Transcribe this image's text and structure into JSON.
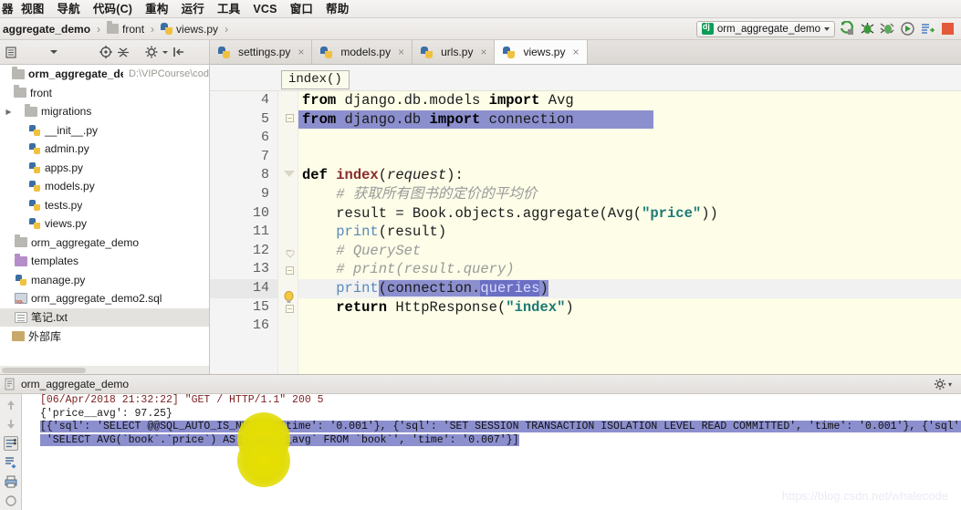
{
  "menu": {
    "items": [
      "器",
      "视图",
      "导航",
      "代码(C)",
      "重构",
      "运行",
      "工具",
      "VCS",
      "窗口",
      "帮助"
    ]
  },
  "breadcrumb": {
    "project": "aggregate_demo",
    "folder": "front",
    "file": "views.py",
    "sep": "›"
  },
  "run_config": {
    "name": "orm_aggregate_demo",
    "icon": "django-icon",
    "dropdown_caret": "▾",
    "buttons": [
      {
        "name": "run-button",
        "label": "Run"
      },
      {
        "name": "debug-button",
        "label": "Debug"
      },
      {
        "name": "coverage-button",
        "label": "Run with Coverage"
      },
      {
        "name": "profile-button",
        "label": "Profile"
      },
      {
        "name": "attach-button",
        "label": "Attach"
      },
      {
        "name": "stop-button",
        "label": "Stop"
      }
    ]
  },
  "project_toolbar": {
    "icons": [
      "list-icon",
      "chevron-down-icon",
      "target-icon",
      "collapse-all-icon",
      "gear-icon",
      "hide-icon"
    ]
  },
  "tabs": [
    {
      "label": "settings.py",
      "active": false,
      "close": "×"
    },
    {
      "label": "models.py",
      "active": false,
      "close": "×"
    },
    {
      "label": "urls.py",
      "active": false,
      "close": "×"
    },
    {
      "label": "views.py",
      "active": true,
      "close": "×"
    }
  ],
  "project_tree": [
    {
      "indent": 0,
      "twist": "",
      "icon": "folder",
      "label": "orm_aggregate_demo",
      "path": "D:\\VIPCourse\\cod",
      "bold": true,
      "selected": false
    },
    {
      "indent": 1,
      "twist": "",
      "icon": "folder",
      "label": "front",
      "path": "",
      "bold": false,
      "selected": false
    },
    {
      "indent": 2,
      "twist": "▶",
      "icon": "folder",
      "label": "migrations",
      "path": "",
      "bold": false,
      "selected": false
    },
    {
      "indent": 3,
      "twist": "",
      "icon": "py",
      "label": "__init__.py",
      "path": "",
      "bold": false,
      "selected": false
    },
    {
      "indent": 3,
      "twist": "",
      "icon": "py",
      "label": "admin.py",
      "path": "",
      "bold": false,
      "selected": false
    },
    {
      "indent": 3,
      "twist": "",
      "icon": "py",
      "label": "apps.py",
      "path": "",
      "bold": false,
      "selected": false
    },
    {
      "indent": 3,
      "twist": "",
      "icon": "py",
      "label": "models.py",
      "path": "",
      "bold": false,
      "selected": false
    },
    {
      "indent": 3,
      "twist": "",
      "icon": "py",
      "label": "tests.py",
      "path": "",
      "bold": false,
      "selected": false
    },
    {
      "indent": 3,
      "twist": "",
      "icon": "py",
      "label": "views.py",
      "path": "",
      "bold": false,
      "selected": false
    },
    {
      "indent": 1,
      "twist": "",
      "icon": "folder",
      "label": "orm_aggregate_demo",
      "path": "",
      "bold": false,
      "selected": false
    },
    {
      "indent": 1,
      "twist": "",
      "icon": "folderPurple",
      "label": "templates",
      "path": "",
      "bold": false,
      "selected": false
    },
    {
      "indent": 1,
      "twist": "",
      "icon": "py",
      "label": "manage.py",
      "path": "",
      "bold": false,
      "selected": false
    },
    {
      "indent": 1,
      "twist": "",
      "icon": "sql",
      "label": "orm_aggregate_demo2.sql",
      "path": "",
      "bold": false,
      "selected": false
    },
    {
      "indent": 1,
      "twist": "",
      "icon": "txt",
      "label": "笔记.txt",
      "path": "",
      "bold": false,
      "selected": true
    },
    {
      "indent": 0,
      "twist": "",
      "icon": "lib",
      "label": "外部库",
      "path": "",
      "bold": false,
      "selected": false
    }
  ],
  "editor": {
    "breadcrumb_chip": "index()",
    "first_line_number": 4,
    "current_line": 14,
    "line_numbers": [
      4,
      5,
      6,
      7,
      8,
      9,
      10,
      11,
      12,
      13,
      14,
      15,
      16
    ],
    "lines": [
      {
        "n": 4,
        "text": "from django.db.models import Avg"
      },
      {
        "n": 5,
        "text": "from django.db import connection"
      },
      {
        "n": 6,
        "text": ""
      },
      {
        "n": 7,
        "text": ""
      },
      {
        "n": 8,
        "text": "def index(request):"
      },
      {
        "n": 9,
        "text": "    # 获取所有图书的定价的平均价"
      },
      {
        "n": 10,
        "text": "    result = Book.objects.aggregate(Avg(\"price\"))"
      },
      {
        "n": 11,
        "text": "    print(result)"
      },
      {
        "n": 12,
        "text": "    # QuerySet"
      },
      {
        "n": 13,
        "text": "    # print(result.query)"
      },
      {
        "n": 14,
        "text": "    print(connection.queries)"
      },
      {
        "n": 15,
        "text": "    return HttpResponse(\"index\")"
      },
      {
        "n": 16,
        "text": ""
      }
    ],
    "tokens": {
      "l4": {
        "kw1": "from",
        "mod": " django.db.models ",
        "kw2": "import",
        "name": " Avg"
      },
      "l5": {
        "kw1": "from",
        "mod": " django.db ",
        "kw2": "import",
        "name": " connection"
      },
      "l8": {
        "kw": "def",
        "fn": "index",
        "open": "(",
        "param": "request",
        "close": "):"
      },
      "l9": {
        "comment": "# 获取所有图书的定价的平均价"
      },
      "l10": {
        "lhs": "result = Book.objects.aggregate(Avg(",
        "str": "\"price\"",
        "rhs": "))"
      },
      "l11": {
        "fn": "print",
        "rest": "(result)"
      },
      "l12": {
        "comment": "# QuerySet"
      },
      "l13": {
        "comment": "# print(result.query)"
      },
      "l14": {
        "fn": "print",
        "mid": "(connection.",
        "selected": "queries",
        "end": ")"
      },
      "l15": {
        "kw": "return",
        "mid": " HttpResponse(",
        "str": "\"index\"",
        "end": ")"
      }
    },
    "selection": {
      "from_line": 5,
      "to_line": 5,
      "label": "import-line-selection"
    }
  },
  "run_panel": {
    "title": "orm_aggregate_demo",
    "gear_icon": "gear-icon",
    "gear_caret": "▾",
    "toolbar_icons": [
      "scroll-up-icon",
      "scroll-down-icon",
      "soft-wrap-icon",
      "scroll-to-end-icon",
      "print-icon",
      "clear-icon"
    ],
    "console_lines": [
      {
        "style": "request",
        "text": "[06/Apr/2018 21:32:22] \"GET / HTTP/1.1\" 200 5"
      },
      {
        "style": "plain",
        "text": "{'price__avg': 97.25}"
      },
      {
        "style": "highlight",
        "text": "[{'sql': 'SELECT @@SQL_AUTO_IS_NULL', 'time': '0.001'}, {'sql': 'SET SESSION TRANSACTION ISOLATION LEVEL READ COMMITTED', 'time': '0.001'}, {'sql':"
      },
      {
        "style": "highlight",
        "text": " 'SELECT AVG(`book`.`price`) AS `price__avg` FROM `book`', 'time': '0.007'}]"
      }
    ]
  },
  "watermark": "https://blog.csdn.net/whalecode",
  "colors": {
    "editor_bg": "#fdfde8",
    "selection": "#8c8fce",
    "selection_strong": "#6a6fc4",
    "string": "#1b7a74",
    "comment": "#9a9a9a",
    "function": "#8a2b2b",
    "builtin": "#5a88b8",
    "request_log": "#7c1f1f",
    "cursor_highlight": "#e2dc08"
  }
}
